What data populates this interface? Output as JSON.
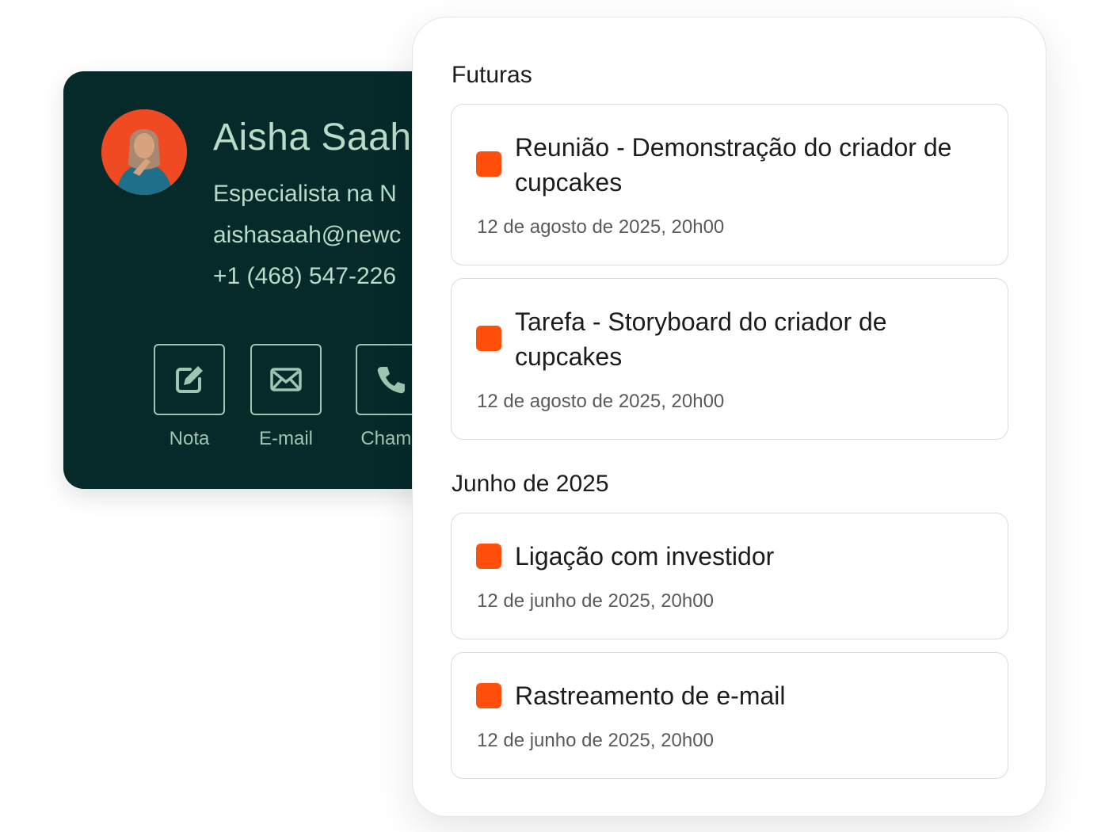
{
  "contact": {
    "name": "Aisha Saah",
    "role": "Especialista na N",
    "email": "aishasaah@newc",
    "phone": "+1 (468) 547-226",
    "avatar_bg": "#f04a23",
    "actions": [
      {
        "label": "Nota",
        "icon": "edit-icon"
      },
      {
        "label": "E-mail",
        "icon": "mail-icon"
      },
      {
        "label": "Chama",
        "icon": "phone-icon"
      }
    ]
  },
  "activity": {
    "sections": [
      {
        "title": "Futuras",
        "items": [
          {
            "title": "Reunião - Demonstração do criador de cupcakes",
            "date": "12 de agosto de 2025, 20h00"
          },
          {
            "title": "Tarefa - Storyboard do criador de cupcakes",
            "date": "12 de agosto de 2025, 20h00"
          }
        ]
      },
      {
        "title": "Junho de 2025",
        "items": [
          {
            "title": "Ligação com investidor",
            "date": "12 de junho de 2025, 20h00"
          },
          {
            "title": "Rastreamento de e-mail",
            "date": "12 de junho de 2025, 20h00"
          }
        ]
      }
    ],
    "status_color": "#ff4f0a"
  }
}
